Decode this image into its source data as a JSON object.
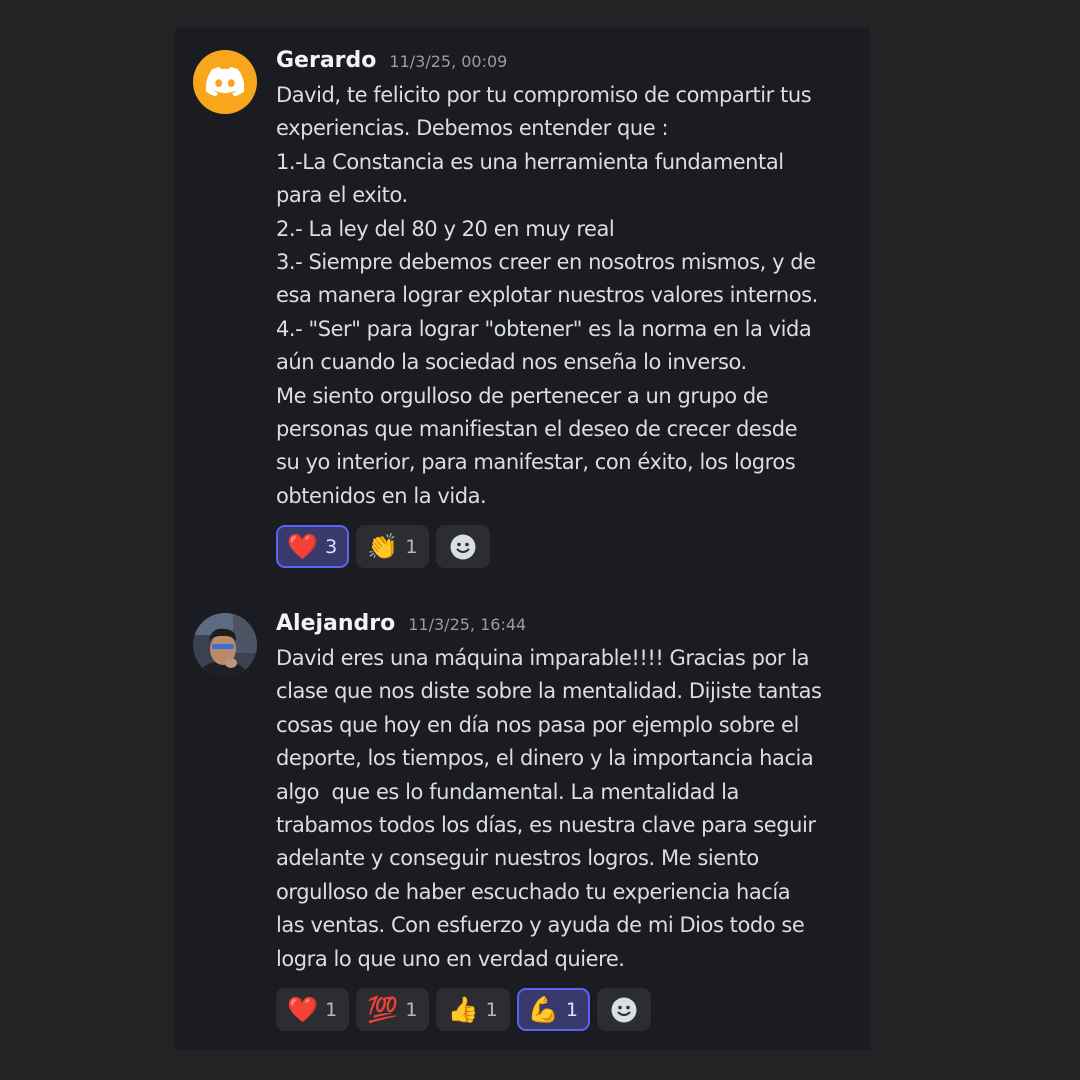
{
  "messages": [
    {
      "username": "Gerardo",
      "timestamp": "11/3/25, 00:09",
      "avatar": "discord-logo-icon",
      "avatar_color": "#f8a61b",
      "lines": [
        "David, te felicito por tu compromiso de compartir tus",
        "experiencias. Debemos entender que :",
        "1.-La Constancia es una herramienta fundamental",
        "para el exito.",
        "2.- La ley del 80 y 20 en muy real",
        "3.- Siempre debemos creer en nosotros mismos, y de",
        "esa manera lograr explotar nuestros valores internos.",
        "4.- \"Ser\" para lograr \"obtener\" es la norma en la vida",
        "aún cuando la sociedad nos enseña lo inverso.",
        "Me siento orgulloso de pertenecer a un grupo de",
        "personas que manifiestan el deseo de crecer desde",
        "su yo interior, para manifestar, con éxito, los logros",
        "obtenidos en la vida."
      ],
      "reactions": [
        {
          "emoji": "❤️",
          "icon": "red-heart-icon",
          "count": "3",
          "active": true
        },
        {
          "emoji": "👏",
          "icon": "clapping-hands-icon",
          "count": "1",
          "active": false
        }
      ]
    },
    {
      "username": "Alejandro",
      "timestamp": "11/3/25, 16:44",
      "avatar": "user-photo-avatar",
      "lines": [
        "David eres una máquina imparable!!!! Gracias por la",
        "clase que nos diste sobre la mentalidad. Dijiste tantas",
        "cosas que hoy en día nos pasa por ejemplo sobre el",
        "deporte, los tiempos, el dinero y la importancia hacia",
        "algo  que es lo fundamental. La mentalidad la",
        "trabamos todos los días, es nuestra clave para seguir",
        "adelante y conseguir nuestros logros. Me siento",
        "orgulloso de haber escuchado tu experiencia hacía",
        "las ventas. Con esfuerzo y ayuda de mi Dios todo se",
        "logra lo que uno en verdad quiere."
      ],
      "reactions": [
        {
          "emoji": "❤️",
          "icon": "red-heart-icon",
          "count": "1",
          "active": false
        },
        {
          "emoji": "💯",
          "icon": "hundred-points-icon",
          "count": "1",
          "active": false
        },
        {
          "emoji": "👍",
          "icon": "thumbs-up-icon",
          "count": "1",
          "active": false
        },
        {
          "emoji": "💪",
          "icon": "flexed-biceps-icon",
          "count": "1",
          "active": true
        }
      ]
    }
  ],
  "add_reaction_icon": "smiley-face-icon",
  "colors": {
    "background": "#232325",
    "panel": "#1b1c22",
    "accent": "#5865f2",
    "reaction_bg": "#2b2d31"
  }
}
